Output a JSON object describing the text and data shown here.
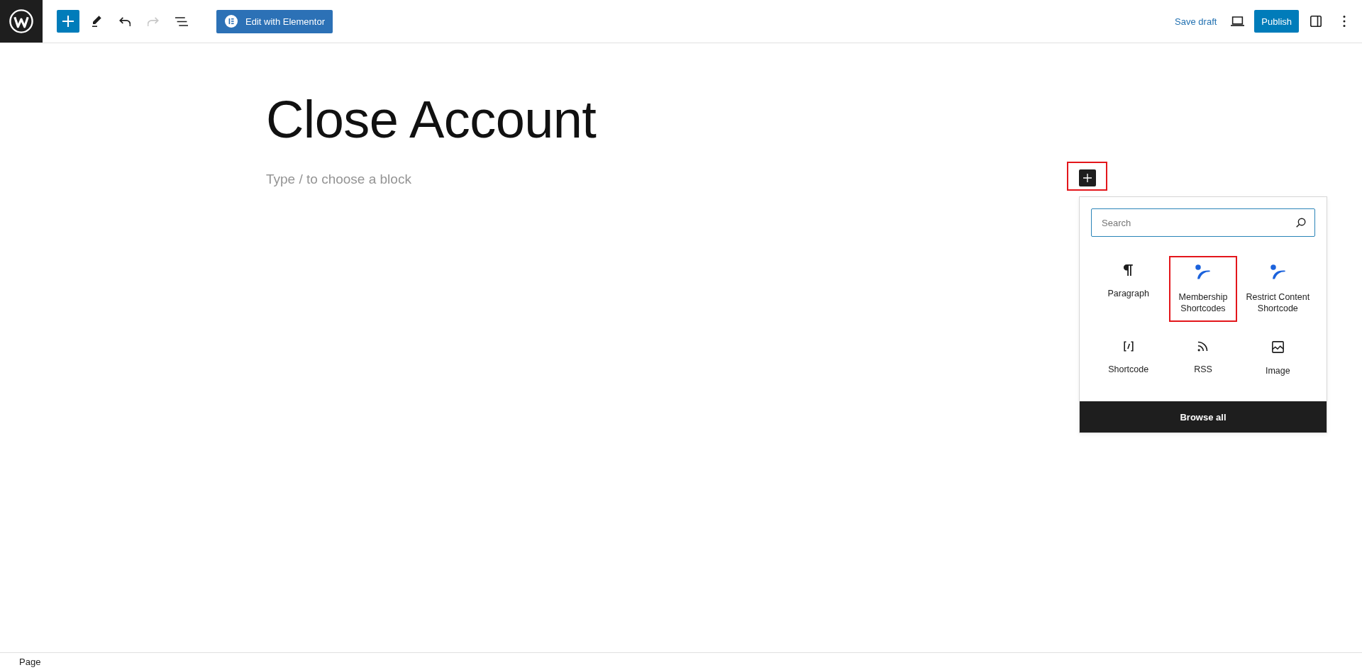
{
  "header": {
    "tools": [
      {
        "kind": "inserter",
        "disabled": false
      },
      {
        "kind": "tools",
        "disabled": false
      },
      {
        "kind": "undo",
        "disabled": false
      },
      {
        "kind": "redo",
        "disabled": true
      },
      {
        "kind": "list_view",
        "disabled": false
      }
    ],
    "editor_button": "Edit with Elementor",
    "save_draft": "Save draft",
    "publish": "Publish"
  },
  "content": {
    "title": "Close Account",
    "block_placeholder": "Type / to choose a block",
    "appender": {
      "highlighted": true
    }
  },
  "inserter": {
    "search": {
      "placeholder": "Search"
    },
    "blocks": [
      {
        "kind": "paragraph",
        "label": "Paragraph",
        "highlighted": false
      },
      {
        "kind": "membership",
        "label": "Membership Shortcodes",
        "highlighted": true
      },
      {
        "kind": "membership",
        "label": "Restrict Content Shortcode",
        "highlighted": false
      },
      {
        "kind": "shortcode",
        "label": "Shortcode",
        "highlighted": false
      },
      {
        "kind": "rss",
        "label": "RSS",
        "highlighted": false
      },
      {
        "kind": "image",
        "label": "Image",
        "highlighted": false
      }
    ],
    "browse_all": "Browse all"
  },
  "status_bar": {
    "breadcrumb": "Page"
  }
}
